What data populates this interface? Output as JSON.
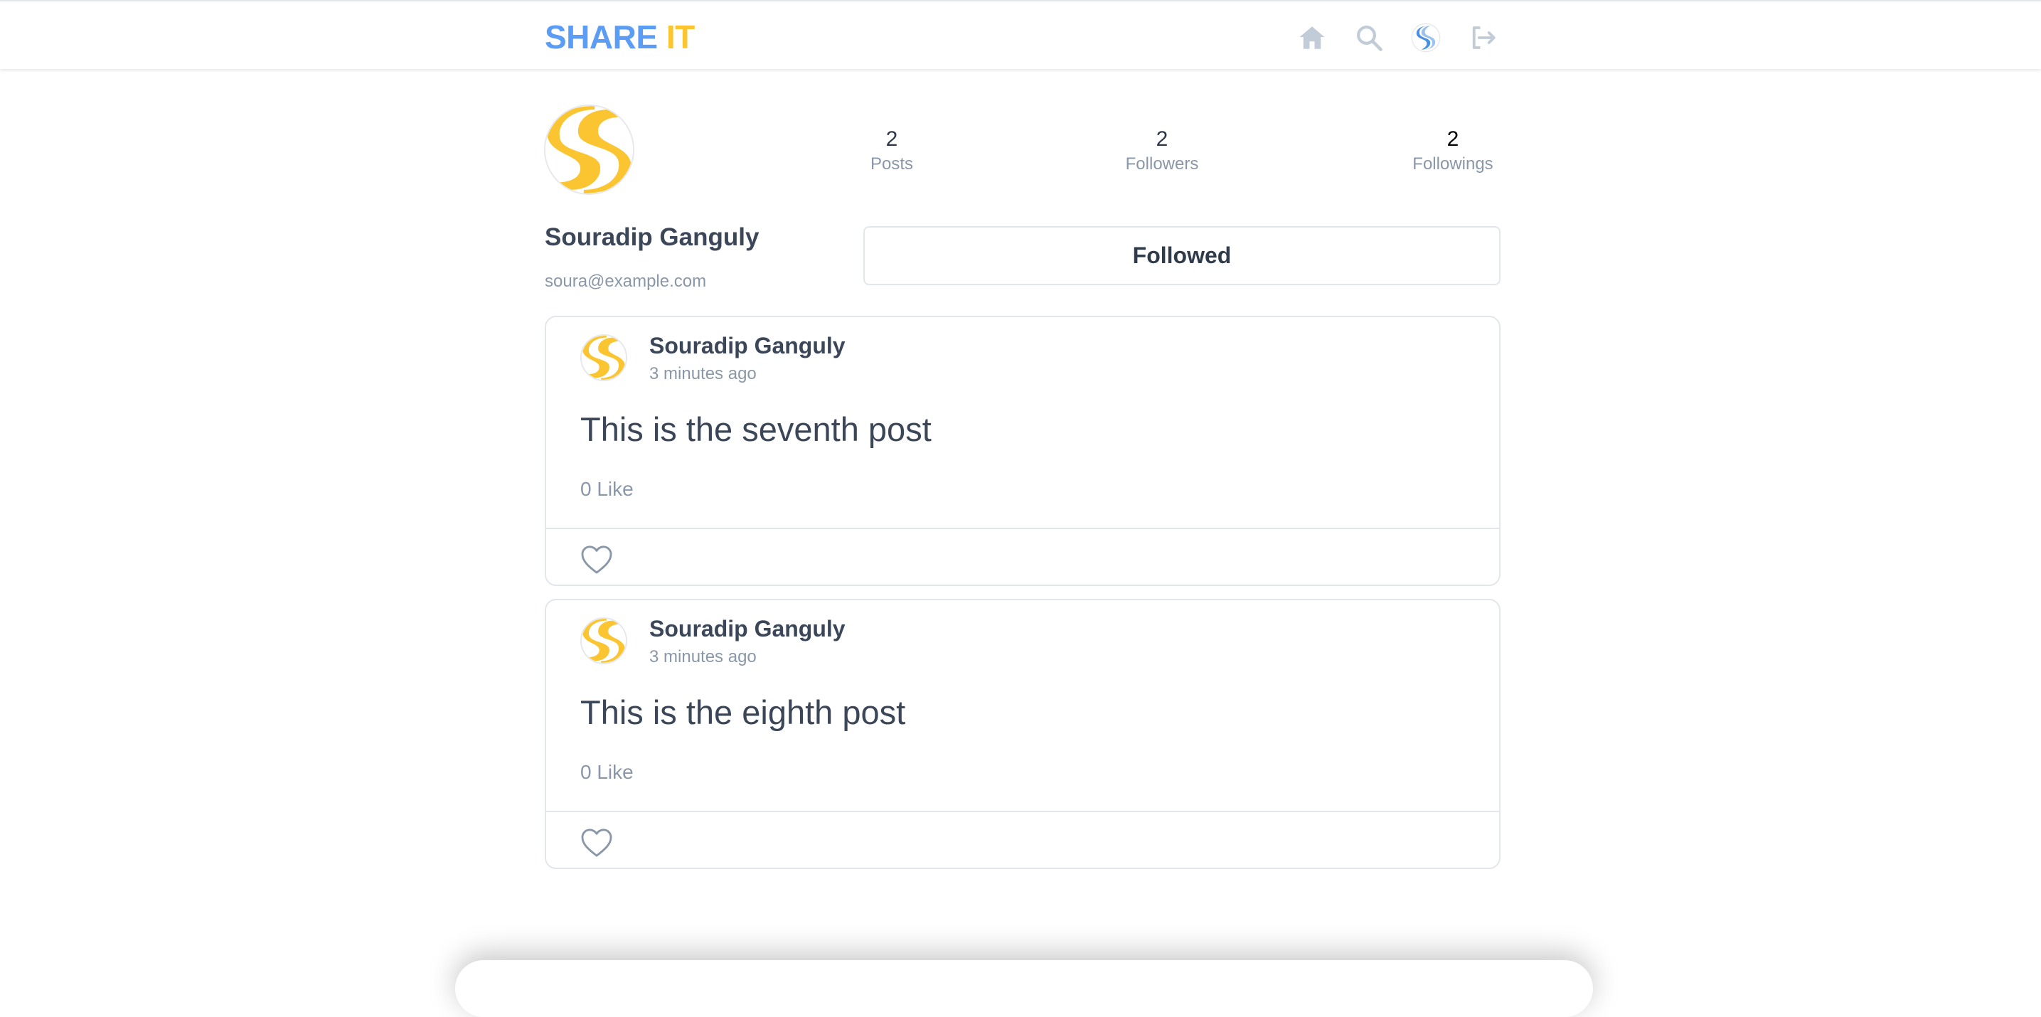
{
  "header": {
    "brand_part1": "SHARE",
    "brand_part2": "IT",
    "nav_icons": [
      "home-icon",
      "search-icon",
      "profile-avatar-icon",
      "logout-icon"
    ],
    "colors": {
      "brand_blue": "#5b9df5",
      "brand_yellow": "#fbc531",
      "icon_gray": "#c2ccd8"
    }
  },
  "profile": {
    "name": "Souradip Ganguly",
    "email": "soura@example.com",
    "stats": [
      {
        "value": "2",
        "label": "Posts"
      },
      {
        "value": "2",
        "label": "Followers"
      },
      {
        "value": "2",
        "label": "Followings"
      }
    ],
    "follow_button": "Followed"
  },
  "posts": [
    {
      "author": "Souradip Ganguly",
      "time": "3 minutes ago",
      "content": "This is the seventh post",
      "likes": "0 Like"
    },
    {
      "author": "Souradip Ganguly",
      "time": "3 minutes ago",
      "content": "This is the eighth post",
      "likes": "0 Like"
    }
  ]
}
